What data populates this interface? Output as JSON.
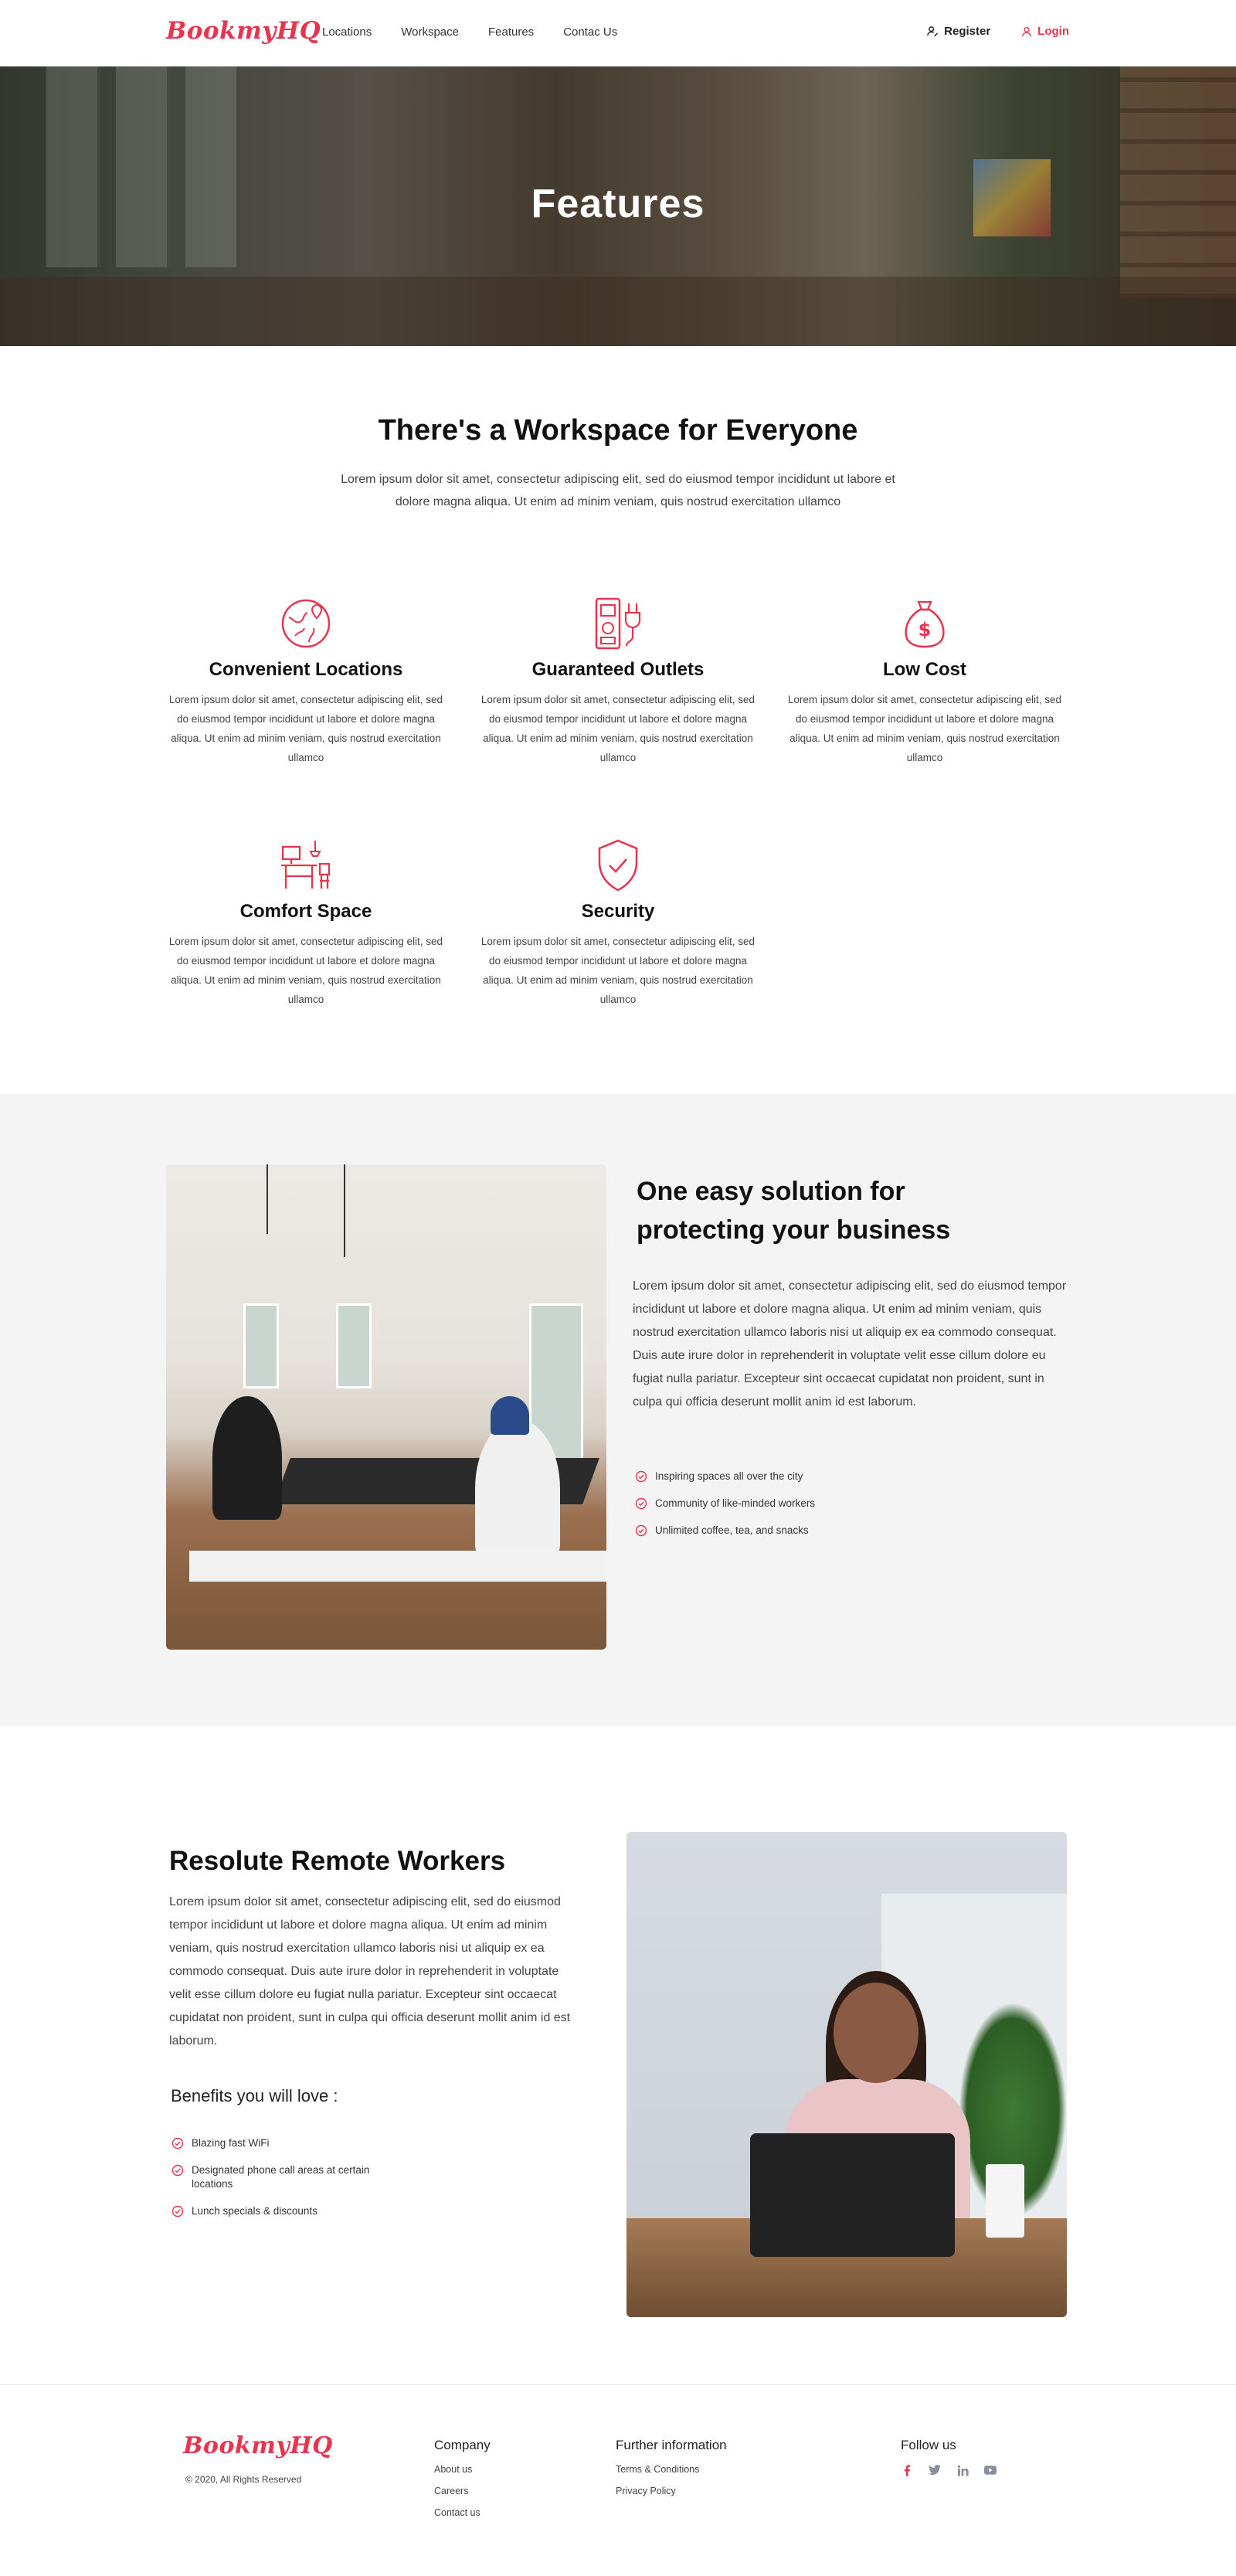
{
  "brand": {
    "name": "BookmyHQ",
    "accent": "#e8344e"
  },
  "nav": {
    "links": [
      "Locations",
      "Workspace",
      "Features",
      "Contac Us"
    ],
    "register": "Register",
    "login": "Login"
  },
  "hero": {
    "title": "Features"
  },
  "workspace": {
    "title": "There's a Workspace for Everyone",
    "description": "Lorem ipsum dolor sit amet, consectetur adipiscing elit, sed do eiusmod tempor incididunt ut labore et dolore magna aliqua. Ut enim ad minim veniam, quis nostrud exercitation ullamco",
    "features": [
      {
        "icon": "globe-pin-icon",
        "title": "Convenient Locations",
        "text": "Lorem ipsum dolor sit amet, consectetur adipiscing elit, sed do eiusmod tempor incididunt ut labore et dolore magna aliqua. Ut enim ad minim veniam, quis nostrud exercitation ullamco"
      },
      {
        "icon": "power-outlet-icon",
        "title": "Guaranteed Outlets",
        "text": "Lorem ipsum dolor sit amet, consectetur adipiscing elit, sed do eiusmod tempor incididunt ut labore et dolore magna aliqua. Ut enim ad minim veniam, quis nostrud exercitation ullamco"
      },
      {
        "icon": "money-bag-icon",
        "title": "Low Cost",
        "text": "Lorem ipsum dolor sit amet, consectetur adipiscing elit, sed do eiusmod tempor incididunt ut labore et dolore magna aliqua. Ut enim ad minim veniam, quis nostrud exercitation ullamco"
      },
      {
        "icon": "desk-chair-icon",
        "title": "Comfort Space",
        "text": "Lorem ipsum dolor sit amet, consectetur adipiscing elit, sed do eiusmod tempor incididunt ut labore et dolore magna aliqua. Ut enim ad minim veniam, quis nostrud exercitation ullamco"
      },
      {
        "icon": "shield-check-icon",
        "title": "Security",
        "text": "Lorem ipsum dolor sit amet, consectetur adipiscing elit, sed do eiusmod tempor incididunt ut labore et dolore magna aliqua. Ut enim ad minim veniam, quis nostrud exercitation ullamco"
      }
    ]
  },
  "solution": {
    "title_line1": "One easy solution for",
    "title_line2": "protecting your business",
    "text": "Lorem ipsum dolor sit amet, consectetur adipiscing elit, sed do eiusmod tempor incididunt ut labore et dolore magna aliqua. Ut enim ad minim veniam, quis nostrud exercitation ullamco laboris nisi ut aliquip ex ea commodo consequat. Duis aute irure dolor in reprehenderit in voluptate velit esse cillum dolore eu fugiat nulla pariatur. Excepteur sint occaecat cupidatat non proident, sunt in culpa qui officia deserunt mollit anim id est laborum.",
    "bullets": [
      "Inspiring spaces all over the city",
      "Community of like-minded workers",
      "Unlimited coffee, tea, and snacks"
    ]
  },
  "remote": {
    "title": "Resolute Remote Workers",
    "text": "Lorem ipsum dolor sit amet, consectetur adipiscing elit, sed do eiusmod tempor incididunt ut labore et dolore magna aliqua. Ut enim ad minim veniam, quis nostrud exercitation ullamco laboris nisi ut aliquip ex ea commodo consequat. Duis aute irure dolor in reprehenderit in voluptate velit esse cillum dolore eu fugiat nulla pariatur. Excepteur sint occaecat cupidatat non proident, sunt in culpa qui officia deserunt mollit anim id est laborum.",
    "benefits_title": "Benefits you will love :",
    "benefits": [
      "Blazing fast WiFi",
      "Designated phone call areas at certain locations",
      "Lunch specials & discounts"
    ]
  },
  "footer": {
    "copyright": "© 2020, All Rights Reserved",
    "company_title": "Company",
    "company_links": [
      "About us",
      "Careers",
      "Contact us"
    ],
    "info_title": "Further information",
    "info_links": [
      "Terms & Conditions",
      "Privacy Policy"
    ],
    "follow_title": "Follow us",
    "social": [
      "facebook-icon",
      "twitter-icon",
      "linkedin-icon",
      "youtube-icon"
    ]
  }
}
